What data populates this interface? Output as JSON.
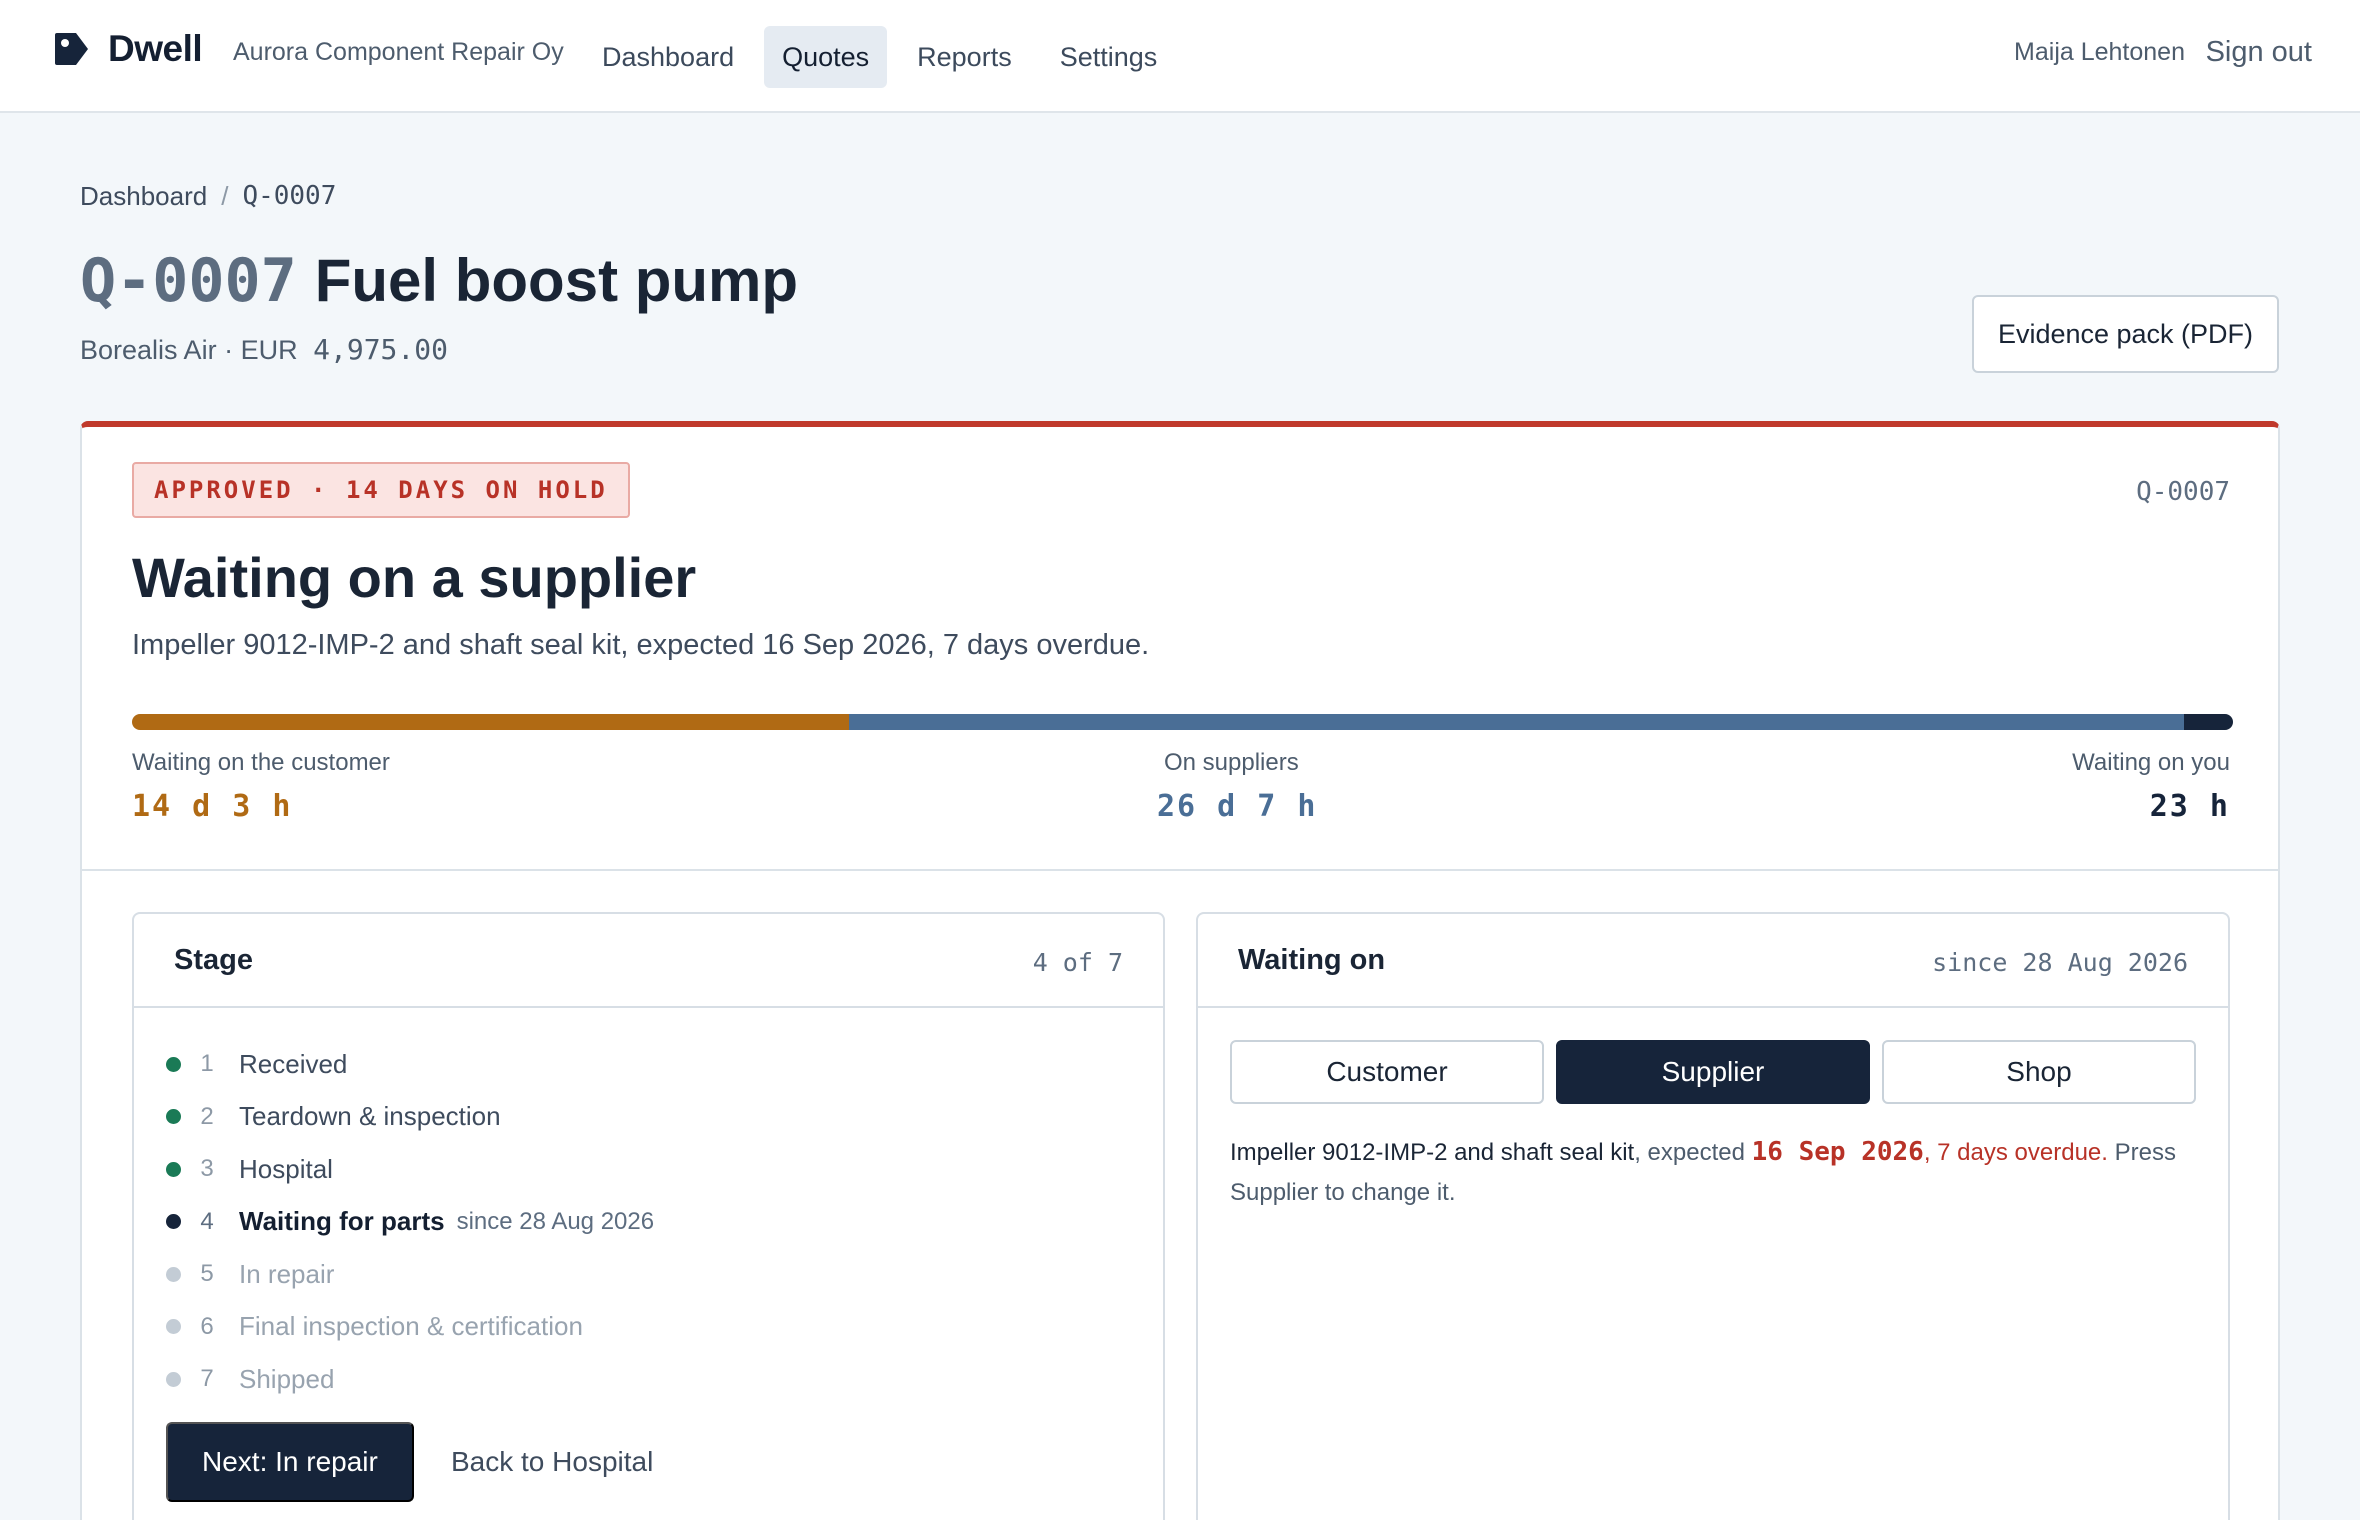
{
  "app": {
    "brand": "Dwell",
    "organization": "Aurora Component Repair Oy",
    "nav": [
      "Dashboard",
      "Quotes",
      "Reports",
      "Settings"
    ],
    "active_nav": "Quotes",
    "user": "Maija Lehtonen",
    "sign_out": "Sign out"
  },
  "breadcrumb": {
    "home": "Dashboard",
    "separator": "/",
    "current": "Q-0007"
  },
  "quote": {
    "id": "Q-0007",
    "title": "Fuel boost pump",
    "customer": "Borealis Air",
    "dot": "·",
    "currency": "EUR",
    "amount": "4,975.00"
  },
  "actions": {
    "evidence_pack": "Evidence pack (PDF)"
  },
  "status": {
    "badge": "APPROVED · 14 DAYS ON HOLD",
    "id": "Q-0007",
    "headline": "Waiting on a supplier",
    "description": "Impeller 9012-IMP-2 and shaft seal kit, expected 16 Sep 2026, 7 days overdue."
  },
  "dwell": {
    "segments": [
      {
        "label": "Waiting on the customer",
        "value": "14 d 3 h",
        "hours": 339,
        "color": "#b06a14"
      },
      {
        "label": "On suppliers",
        "value": "26 d 7 h",
        "hours": 631,
        "color": "#4a6e96"
      },
      {
        "label": "Waiting on you",
        "value": "23 h",
        "hours": 23,
        "color": "#16243a"
      }
    ]
  },
  "stage_panel": {
    "title": "Stage",
    "progress": "4 of 7",
    "stages": [
      {
        "num": "1",
        "name": "Received",
        "state": "done"
      },
      {
        "num": "2",
        "name": "Teardown & inspection",
        "state": "done"
      },
      {
        "num": "3",
        "name": "Hospital",
        "state": "done"
      },
      {
        "num": "4",
        "name": "Waiting for parts",
        "state": "current",
        "since": "since 28 Aug 2026"
      },
      {
        "num": "5",
        "name": "In repair",
        "state": "pending"
      },
      {
        "num": "6",
        "name": "Final inspection & certification",
        "state": "pending"
      },
      {
        "num": "7",
        "name": "Shipped",
        "state": "pending"
      }
    ],
    "next_button": "Next: In repair",
    "back_link": "Back to Hospital"
  },
  "waiting_panel": {
    "title": "Waiting on",
    "since": "since 28 Aug 2026",
    "options": [
      "Customer",
      "Supplier",
      "Shop"
    ],
    "selected": "Supplier",
    "text": {
      "item": "Impeller 9012-IMP-2 and shaft seal kit",
      "expected_prefix": ", expected ",
      "date": "16 Sep 2026",
      "overdue": ", 7 days overdue.",
      "suffix": " Press Supplier to change it."
    }
  },
  "colors": {
    "accent_red": "#c0392b",
    "navy": "#16243a",
    "done_green": "#1a7a56",
    "customer_amber": "#b06a14",
    "supplier_blue": "#4a6e96"
  }
}
